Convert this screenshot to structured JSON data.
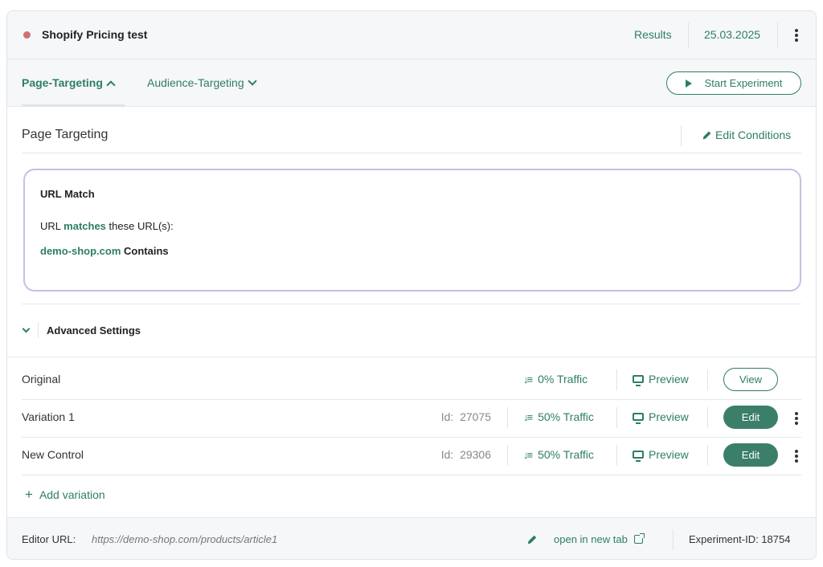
{
  "header": {
    "status_color": "#d07070",
    "title": "Shopify Pricing test",
    "results_label": "Results",
    "date": "25.03.2025"
  },
  "tabs": {
    "page_targeting": "Page-Targeting",
    "audience_targeting": "Audience-Targeting",
    "start_experiment": "Start Experiment"
  },
  "targeting": {
    "section_title": "Page Targeting",
    "edit_conditions": "Edit Conditions",
    "url_match_title": "URL Match",
    "url_prefix": "URL",
    "url_match_word": "matches",
    "url_suffix": "these URL(s):",
    "domain": "demo-shop.com",
    "condition": "Contains"
  },
  "advanced_settings": "Advanced Settings",
  "variations": [
    {
      "name": "Original",
      "id_label": "",
      "id": "",
      "traffic": "0% Traffic",
      "preview": "Preview",
      "action": "View"
    },
    {
      "name": "Variation 1",
      "id_label": "Id:",
      "id": "27075",
      "traffic": "50% Traffic",
      "preview": "Preview",
      "action": "Edit"
    },
    {
      "name": "New Control",
      "id_label": "Id:",
      "id": "29306",
      "traffic": "50% Traffic",
      "preview": "Preview",
      "action": "Edit"
    }
  ],
  "add_variation": "Add variation",
  "footer": {
    "editor_url_label": "Editor URL:",
    "editor_url": "https://demo-shop.com/products/article1",
    "open_new_tab": "open in new tab",
    "experiment_id": "Experiment-ID: 18754"
  },
  "colors": {
    "accent": "#2e7d66",
    "edit_button": "#3b7f6a",
    "url_box_border": "#c7bfe6"
  }
}
